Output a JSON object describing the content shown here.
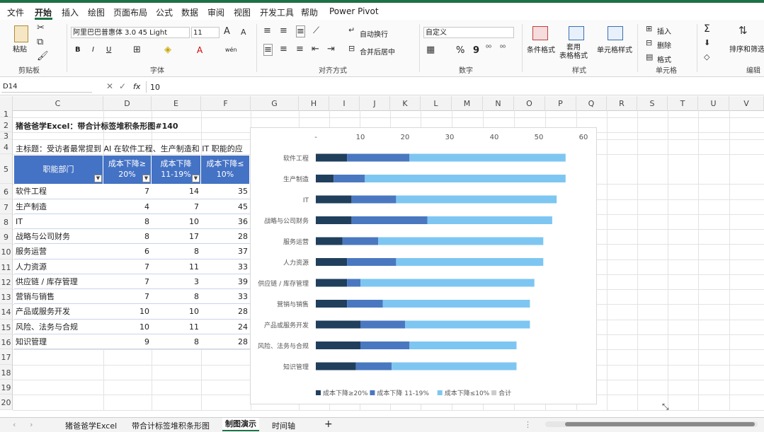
{
  "menu": [
    "文件",
    "开始",
    "插入",
    "绘图",
    "页面布局",
    "公式",
    "数据",
    "审阅",
    "视图",
    "开发工具",
    "帮助",
    "Power Pivot"
  ],
  "ribbon": {
    "paste": "粘贴",
    "clipboard": "剪贴板",
    "font_name": "阿里巴巴普惠体 3.0 45 Light",
    "font_size": "11",
    "font_group": "字体",
    "wrap_text": "自动换行",
    "merge_center": "合并后居中",
    "alignment_group": "对齐方式",
    "number_format": "自定义",
    "number_group": "数字",
    "cond_format": "条件格式",
    "table_format": "套用\n表格格式",
    "cell_styles": "单元格样式",
    "styles_group": "样式",
    "insert": "插入",
    "delete": "删除",
    "format": "格式",
    "cells_group": "单元格",
    "sort_filter": "排序和筛选",
    "editing_group": "编辑",
    "bold": "B",
    "italic": "I",
    "underline": "U",
    "font_a": "A",
    "wen": "wén",
    "percent": "%",
    "comma": "9",
    "sum": "Σ",
    "font_grow": "A",
    "font_shrink": "A"
  },
  "formula_bar": {
    "name_box": "D14",
    "fx": "fx",
    "content": "10"
  },
  "columns": [
    "C",
    "D",
    "E",
    "F",
    "G",
    "H",
    "I",
    "J",
    "K",
    "L",
    "M",
    "N",
    "O",
    "P",
    "Q",
    "R",
    "S",
    "T",
    "U",
    "V"
  ],
  "rows": [
    "1",
    "2",
    "3",
    "4",
    "5",
    "6",
    "7",
    "8",
    "9",
    "10",
    "11",
    "12",
    "13",
    "14",
    "15",
    "16",
    "17",
    "18",
    "19",
    "20"
  ],
  "sheet": {
    "title": "猪爸爸学Excel：带合计标签堆积条形图#140",
    "subtitle": "主标题：受访者最常提到 AI 在软件工程、生产制造和 IT 职能的应",
    "headers": [
      "职能部门",
      "成本下降≥\n20%",
      "成本下降\n11-19%",
      "成本下降≤\n10%"
    ],
    "table": [
      {
        "dept": "软件工程",
        "a": 7,
        "b": 14,
        "c": 35
      },
      {
        "dept": "生产制造",
        "a": 4,
        "b": 7,
        "c": 45
      },
      {
        "dept": "IT",
        "a": 8,
        "b": 10,
        "c": 36
      },
      {
        "dept": "战略与公司财务",
        "a": 8,
        "b": 17,
        "c": 28
      },
      {
        "dept": "服务运营",
        "a": 6,
        "b": 8,
        "c": 37
      },
      {
        "dept": "人力资源",
        "a": 7,
        "b": 11,
        "c": 33
      },
      {
        "dept": "供应链 / 库存管理",
        "a": 7,
        "b": 3,
        "c": 39
      },
      {
        "dept": "营销与销售",
        "a": 7,
        "b": 8,
        "c": 33
      },
      {
        "dept": "产品或服务开发",
        "a": 10,
        "b": 10,
        "c": 28
      },
      {
        "dept": "风险、法务与合规",
        "a": 10,
        "b": 11,
        "c": 24
      },
      {
        "dept": "知识管理",
        "a": 9,
        "b": 8,
        "c": 28
      }
    ]
  },
  "chart_data": {
    "type": "bar",
    "orientation": "horizontal",
    "stacked": true,
    "categories": [
      "软件工程",
      "生产制造",
      "IT",
      "战略与公司财务",
      "服务运营",
      "人力资源",
      "供应链 / 库存管理",
      "营销与销售",
      "产品或服务开发",
      "风险、法务与合规",
      "知识管理"
    ],
    "series": [
      {
        "name": "成本下降≥20%",
        "values": [
          7,
          4,
          8,
          8,
          6,
          7,
          7,
          7,
          10,
          10,
          9
        ],
        "color": "#203f5c"
      },
      {
        "name": "成本下降 11-19%",
        "values": [
          14,
          7,
          10,
          17,
          8,
          11,
          3,
          8,
          10,
          11,
          8
        ],
        "color": "#4a78c0"
      },
      {
        "name": "成本下降≤10%",
        "values": [
          35,
          45,
          36,
          28,
          37,
          33,
          39,
          33,
          28,
          24,
          28
        ],
        "color": "#7ec6f2"
      },
      {
        "name": "合计",
        "values": [
          56,
          56,
          54,
          53,
          51,
          51,
          49,
          48,
          48,
          45,
          45
        ],
        "color": "#cccccc"
      }
    ],
    "xticks": [
      "-",
      "10",
      "20",
      "30",
      "40",
      "50",
      "60"
    ],
    "xlim": [
      0,
      60
    ],
    "legend_position": "bottom",
    "grid": false
  },
  "tabs": {
    "items": [
      "猪爸爸学Excel",
      "带合计标签堆积条形图",
      "制图演示",
      "时间轴"
    ],
    "active": 2,
    "add": "+"
  },
  "colors": {
    "excel_green": "#1e7145",
    "header_blue": "#4472c4"
  }
}
